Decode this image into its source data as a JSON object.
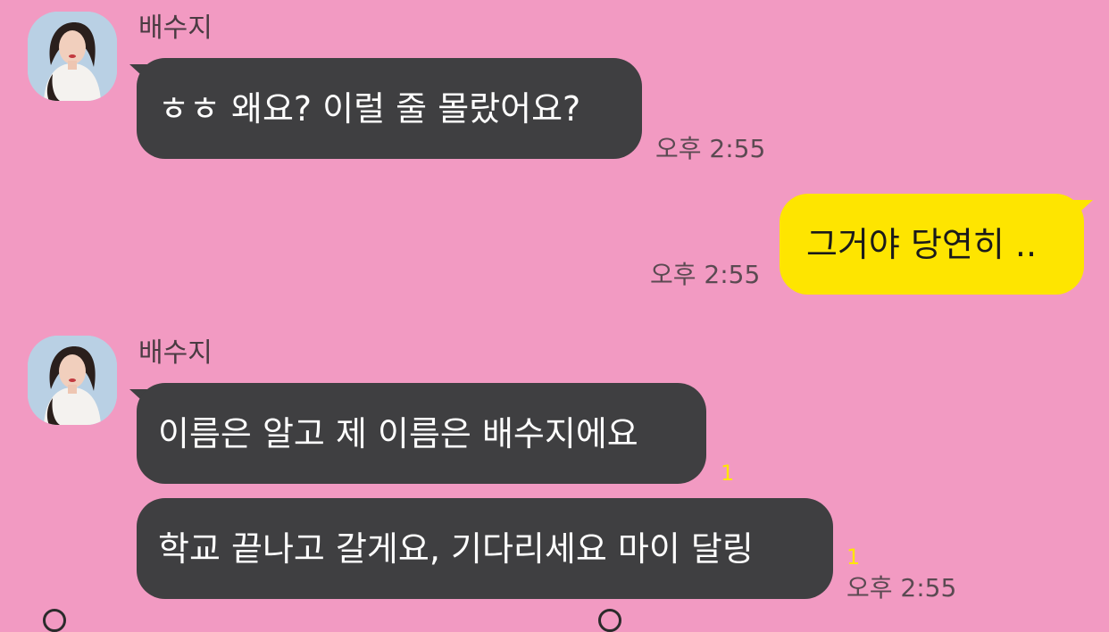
{
  "chat": {
    "contact_name": "배수지",
    "messages": [
      {
        "text": "ㅎㅎ 왜요? 이럴 줄 몰랐어요?",
        "time": "오후 2:55"
      },
      {
        "text": "그거야 당연히 ..",
        "time": "오후 2:55"
      },
      {
        "text": "이름은 알고 제 이름은 배수지에요",
        "unread": "1"
      },
      {
        "text": "학교 끝나고 갈게요, 기다리세요 마이 달링",
        "unread": "1",
        "time": "오후 2:55"
      }
    ]
  },
  "colors": {
    "background": "#f29ac2",
    "received_bubble": "#3f3f41",
    "sent_bubble": "#fee500",
    "unread_count": "#ffe600"
  },
  "icons": [
    "profile-avatar"
  ]
}
